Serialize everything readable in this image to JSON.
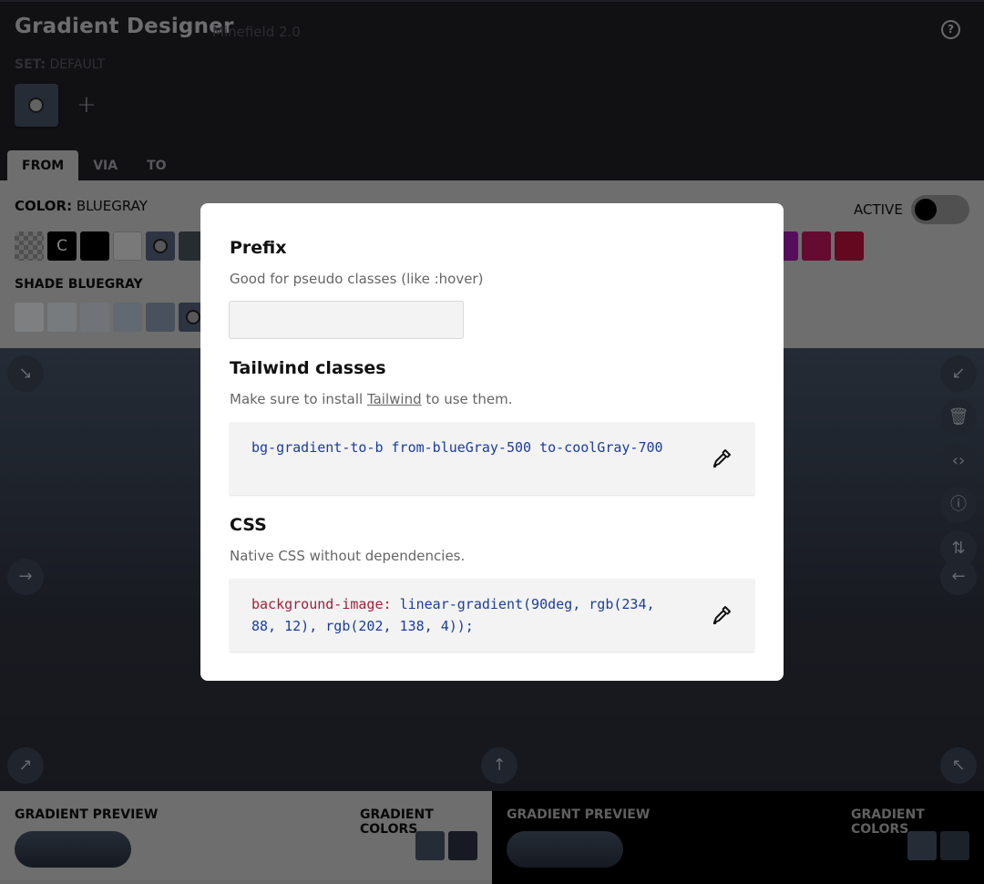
{
  "header": {
    "title": "Gradient Designer",
    "version": "Minefield 2.0",
    "set_prefix": "SET:",
    "set_name": "DEFAULT",
    "help_glyph": "?",
    "add_glyph": "+"
  },
  "tabs": [
    {
      "label": "FROM",
      "active": true
    },
    {
      "label": "VIA",
      "active": false
    },
    {
      "label": "TO",
      "active": false
    }
  ],
  "color_section": {
    "color_prefix": "COLOR:",
    "color_name": "BLUEGRAY",
    "active_label": "ACTIVE",
    "active": false,
    "shade_label": "SHADE BLUEGRAY",
    "current_glyph": "C",
    "swatches_left": [
      "transparent",
      "current",
      "#000000",
      "#ffffff",
      "#64748b",
      "#475569"
    ],
    "swatches_right": [
      "#c026d3",
      "#db2777",
      "#e11d48"
    ],
    "shades": [
      "#f8fafc",
      "#f1f5f9",
      "#e2e8f0",
      "#cbd5e1",
      "#94a3b8",
      "#64748b"
    ]
  },
  "direction_icons": [
    "arrow-down-right-icon",
    "arrow-down-left-icon",
    "arrow-right-icon",
    "arrow-left-icon",
    "arrow-up-right-icon",
    "arrow-up-icon",
    "arrow-up-left-icon",
    "trash-icon",
    "code-icon",
    "info-icon",
    "swap-vertical-icon"
  ],
  "bottom": {
    "left": {
      "preview_label": "GRADIENT PREVIEW",
      "colors_label": "GRADIENT COLORS",
      "colors": [
        "#475569",
        "#374151"
      ]
    },
    "right": {
      "preview_label": "GRADIENT PREVIEW",
      "colors_label": "GRADIENT COLORS",
      "colors": [
        "#475569",
        "#374151"
      ]
    }
  },
  "modal": {
    "prefix_title": "Prefix",
    "prefix_desc": "Good for pseudo classes (like :hover)",
    "prefix_value": "",
    "tailwind_title": "Tailwind classes",
    "tailwind_desc_before": "Make sure to install ",
    "tailwind_link": "Tailwind",
    "tailwind_desc_after": " to use them.",
    "tailwind_code": "bg-gradient-to-b from-blueGray-500 to-coolGray-700",
    "css_title": "CSS",
    "css_desc": "Native CSS without dependencies.",
    "css_property": "background-image:",
    "css_value": "linear-gradient(90deg, rgb(234, 88, 12), rgb(202, 138, 4));"
  }
}
